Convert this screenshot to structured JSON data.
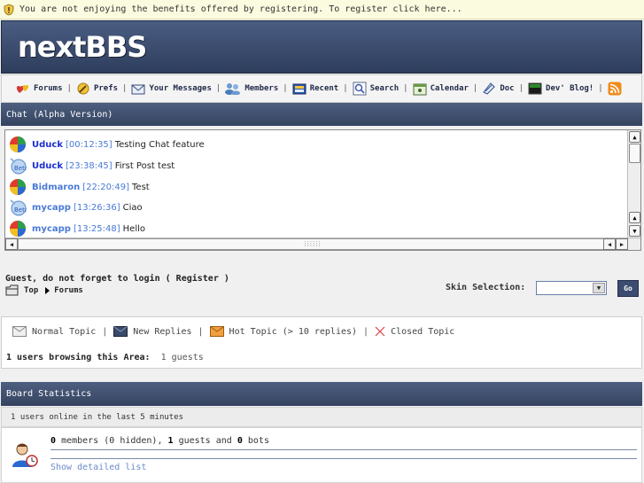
{
  "notice": {
    "text": "You are not enjoying the benefits offered by registering. To register click here..."
  },
  "header": {
    "logo": "nextBBS"
  },
  "nav": {
    "items": [
      {
        "label": "Forums",
        "icon": "hearts-icon"
      },
      {
        "label": "Prefs",
        "icon": "wrench-icon"
      },
      {
        "label": "Your Messages",
        "icon": "envelope-icon"
      },
      {
        "label": "Members",
        "icon": "members-icon"
      },
      {
        "label": "Recent",
        "icon": "recent-icon"
      },
      {
        "label": "Search",
        "icon": "search-icon"
      },
      {
        "label": "Calendar",
        "icon": "calendar-icon"
      },
      {
        "label": "Doc",
        "icon": "doc-icon"
      },
      {
        "label": "Dev' Blog!",
        "icon": "terminal-icon"
      },
      {
        "label": "",
        "icon": "rss-icon"
      }
    ]
  },
  "chat": {
    "title": "Chat (Alpha Version)",
    "messages": [
      {
        "user": "Uduck",
        "time": "[00:12:35]",
        "text": "Testing Chat feature",
        "user_color": "#1a2fd0",
        "avatar": "pie-avatar-icon"
      },
      {
        "user": "Uduck",
        "time": "[23:38:45]",
        "text": "First Post test",
        "user_color": "#1a2fd0",
        "avatar": "beta-avatar-icon"
      },
      {
        "user": "Bidmaron",
        "time": "[22:20:49]",
        "text": "Test",
        "user_color": "#4a7ad8",
        "avatar": "pie-avatar-icon"
      },
      {
        "user": "mycapp",
        "time": "[13:26:36]",
        "text": "Ciao",
        "user_color": "#4a7ad8",
        "avatar": "beta-avatar-icon"
      },
      {
        "user": "mycapp",
        "time": "[13:25:48]",
        "text": "Hello",
        "user_color": "#4a7ad8",
        "avatar": "pie-avatar-icon"
      }
    ]
  },
  "login": {
    "text": "Guest, do not forget to login",
    "register": "( Register )"
  },
  "breadcrumb": {
    "top": "Top",
    "forums": "Forums"
  },
  "skin": {
    "label": "Skin Selection:",
    "value": "",
    "go": "Go"
  },
  "legend": {
    "normal": "Normal Topic",
    "new_replies": "New Replies",
    "hot": "Hot Topic (> 10 replies)",
    "closed": "Closed Topic"
  },
  "browsing": {
    "label": "1 users browsing this Area:",
    "guests": "1 guests"
  },
  "stats": {
    "title": "Board Statistics",
    "online_last": "1 users online in the last 5 minutes",
    "members": "0",
    "members_label": "members (",
    "hidden": "0",
    "hidden_label": "hidden),",
    "guests": "1",
    "guests_label": "guests and",
    "bots": "0",
    "bots_label": "bots",
    "detail_link": "Show detailed list"
  }
}
